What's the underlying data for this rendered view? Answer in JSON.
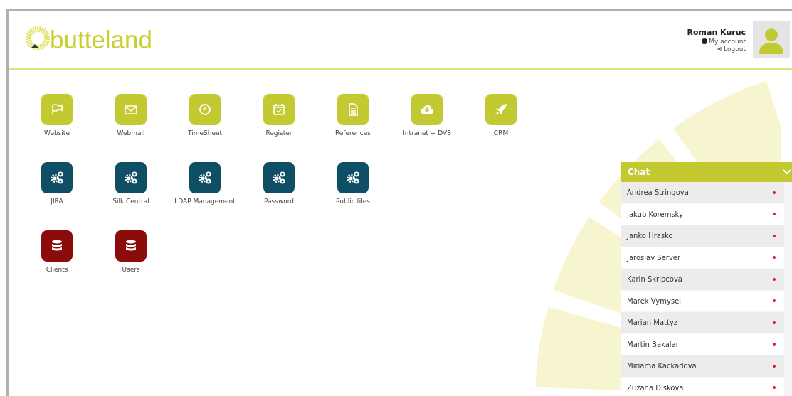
{
  "logo": {
    "text": "butteland"
  },
  "user": {
    "name": "Roman Kuruc",
    "links": [
      {
        "kind": "account",
        "label": "My account"
      },
      {
        "kind": "logout",
        "label": "Logout"
      }
    ]
  },
  "app_rows": [
    {
      "apps": [
        {
          "label": "Website",
          "kind": "flag",
          "color": "#c2c931"
        },
        {
          "label": "Webmail",
          "kind": "mail",
          "color": "#c2c931"
        },
        {
          "label": "TimeSheet",
          "kind": "clock",
          "color": "#c2c931"
        },
        {
          "label": "Register",
          "kind": "calendar",
          "color": "#c2c931"
        },
        {
          "label": "References",
          "kind": "document",
          "color": "#c2c931"
        },
        {
          "label": "Intranet + DVS",
          "kind": "cloud",
          "color": "#c2c931"
        },
        {
          "label": "CRM",
          "kind": "rocket",
          "color": "#c2c931"
        }
      ]
    },
    {
      "apps": [
        {
          "label": "JIRA",
          "kind": "gears",
          "color": "#0f4f66"
        },
        {
          "label": "Silk Central",
          "kind": "gears",
          "color": "#0f4f66"
        },
        {
          "label": "LDAP Management",
          "kind": "gears",
          "color": "#0f4f66"
        },
        {
          "label": "Password",
          "kind": "gears",
          "color": "#0f4f66"
        },
        {
          "label": "Public files",
          "kind": "gears",
          "color": "#0f4f66"
        }
      ]
    },
    {
      "apps": [
        {
          "label": "Clients",
          "kind": "database",
          "color": "#8c0b0b"
        },
        {
          "label": "Users",
          "kind": "database",
          "color": "#8c0b0b"
        }
      ]
    }
  ],
  "chat": {
    "title": "Chat",
    "expanded": true,
    "contacts": [
      {
        "name": "Andrea Stringova",
        "color": "#e8141e"
      },
      {
        "name": "Jakub Koremsky",
        "color": "#e8141e"
      },
      {
        "name": "Janko Hrasko",
        "color": "#e8141e"
      },
      {
        "name": "Jaroslav Server",
        "color": "#e8141e"
      },
      {
        "name": "Karin Skripcova",
        "color": "#e8141e"
      },
      {
        "name": "Marek Vymysel",
        "color": "#e8141e"
      },
      {
        "name": "Marian Mattyz",
        "color": "#e8141e"
      },
      {
        "name": "Martin Bakalar",
        "color": "#e8141e"
      },
      {
        "name": "Miriama Kackadova",
        "color": "#e8141e"
      },
      {
        "name": "Zuzana Dlskova",
        "color": "#e8141e"
      }
    ]
  }
}
